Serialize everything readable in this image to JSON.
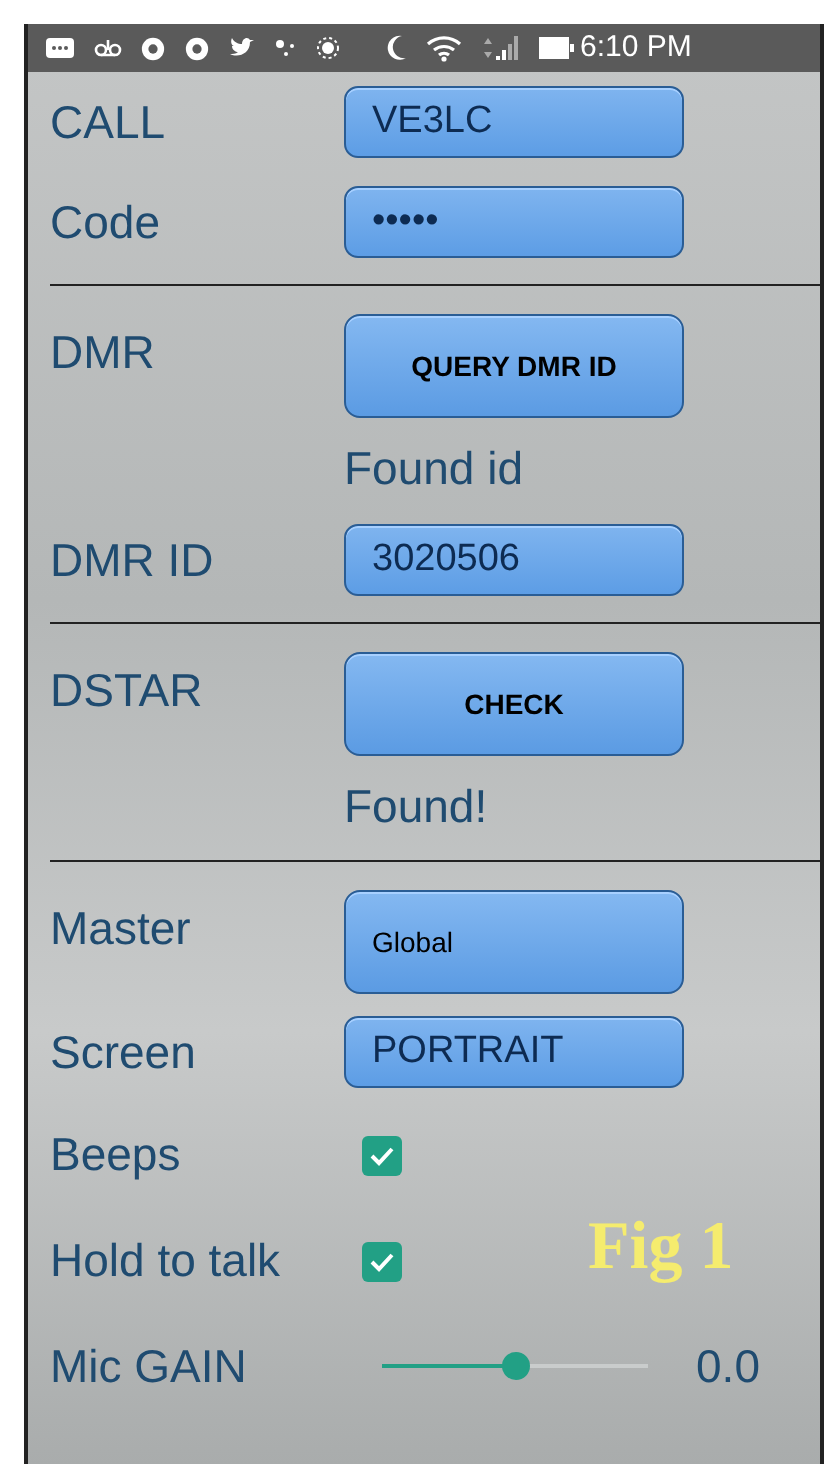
{
  "status_bar": {
    "time": "6:10 PM"
  },
  "rows": [
    {
      "kind": "field",
      "label": "CALL",
      "value": "VE3LC"
    },
    {
      "kind": "field",
      "label": "Code",
      "value": "•••••"
    },
    {
      "kind": "divider"
    },
    {
      "kind": "button",
      "label": "DMR",
      "button": "QUERY DMR ID"
    },
    {
      "kind": "note",
      "text": "Found id"
    },
    {
      "kind": "field",
      "label": "DMR ID",
      "value": "3020506"
    },
    {
      "kind": "divider"
    },
    {
      "kind": "button",
      "label": "DSTAR",
      "button": "CHECK"
    },
    {
      "kind": "note",
      "text": "Found!"
    },
    {
      "kind": "divider"
    },
    {
      "kind": "select",
      "label": "Master",
      "button": "Global"
    },
    {
      "kind": "field",
      "label": "Screen",
      "value": "PORTRAIT"
    },
    {
      "kind": "checkbox",
      "label": "Beeps",
      "checked": true
    },
    {
      "kind": "checkbox",
      "label": "Hold to talk",
      "checked": true
    },
    {
      "kind": "slider",
      "label": "Mic GAIN",
      "level": 0.5,
      "reading": "0.0"
    }
  ],
  "figure_label": "Fig 1"
}
